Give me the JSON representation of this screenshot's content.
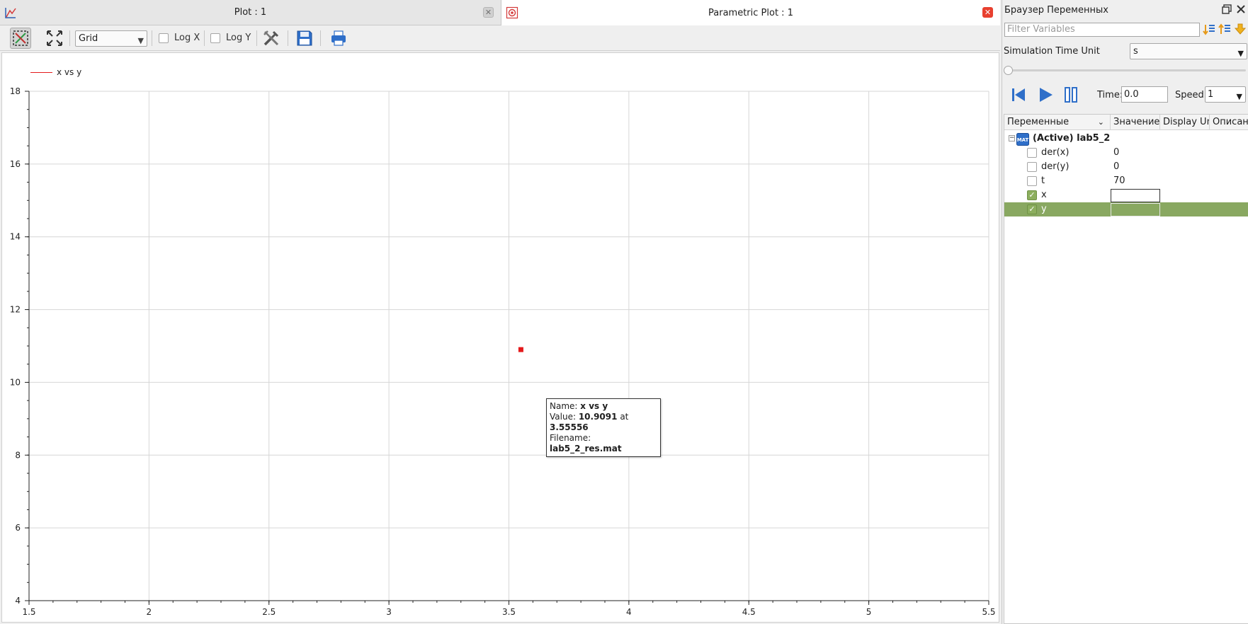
{
  "tabs": [
    {
      "title": "Plot : 1",
      "active": false
    },
    {
      "title": "Parametric Plot : 1",
      "active": true
    }
  ],
  "toolbar": {
    "grid_mode": "Grid",
    "log_x_label": "Log X",
    "log_y_label": "Log Y",
    "log_x_checked": false,
    "log_y_checked": false
  },
  "plot": {
    "legend_label": "x vs y",
    "tooltip": {
      "name_label": "Name:",
      "name_value": "x vs y",
      "value_label": "Value:",
      "value_y": "10.9091",
      "value_at": "at",
      "value_x": "3.55556",
      "filename_label": "Filename:",
      "filename_value": "lab5_2_res.mat"
    }
  },
  "chart_data": {
    "type": "scatter",
    "x": [
      3.55
    ],
    "y": [
      10.9
    ],
    "xlim": [
      1.5,
      5.5
    ],
    "ylim": [
      4,
      18
    ],
    "x_ticks": [
      "1.5",
      "2",
      "2.5",
      "3",
      "3.5",
      "4",
      "4.5",
      "5",
      "5.5"
    ],
    "y_ticks": [
      "4",
      "6",
      "8",
      "10",
      "12",
      "14",
      "16",
      "18"
    ],
    "grid": true,
    "series_color": "#e41a1c",
    "legend": "top-left"
  },
  "variables_browser": {
    "title": "Браузер Переменных",
    "filter_placeholder": "Filter Variables",
    "sim_time_unit_label": "Simulation Time Unit",
    "sim_time_unit_value": "s",
    "time_label": "Time:",
    "time_value": "0.0",
    "speed_label": "Speed:",
    "speed_value": "1",
    "columns": [
      "Переменные",
      "Значение",
      "Display Un",
      "Описани"
    ],
    "root_label": "(Active) lab5_2",
    "rows": [
      {
        "name": "der(x)",
        "value": "0",
        "checked": false
      },
      {
        "name": "der(y)",
        "value": "0",
        "checked": false
      },
      {
        "name": "t",
        "value": "70",
        "checked": false
      },
      {
        "name": "x",
        "value": "",
        "checked": true
      },
      {
        "name": "y",
        "value": "",
        "checked": true,
        "selected": true
      }
    ]
  }
}
